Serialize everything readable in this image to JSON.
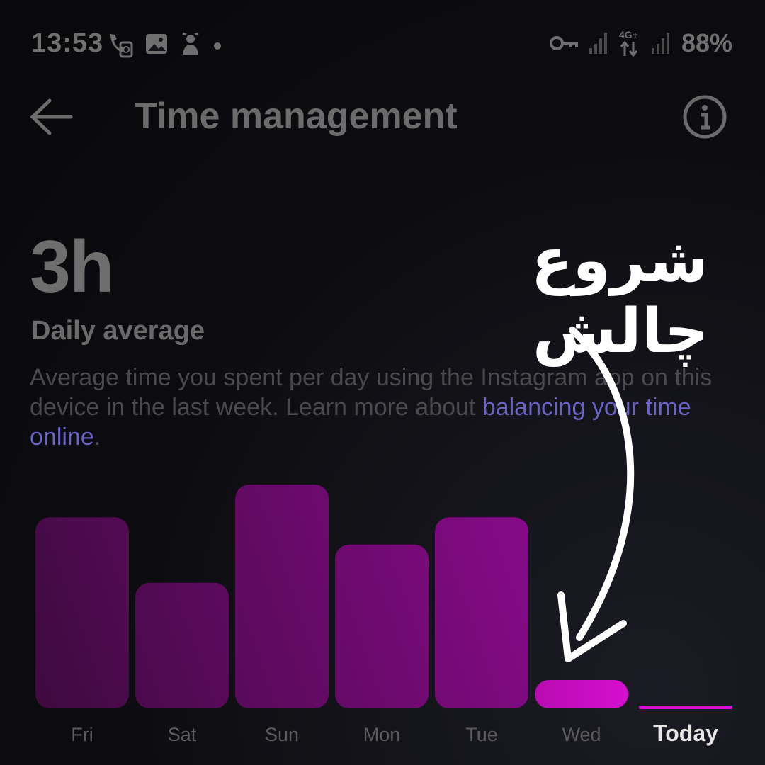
{
  "status_bar": {
    "time": "13:53",
    "battery": "88%",
    "network": "4G+"
  },
  "header": {
    "title": "Time management"
  },
  "summary": {
    "value": "3h",
    "label": "Daily average",
    "description_plain": "Average time you spent per day using the Instagram app on this device in the last week. Learn more about ",
    "description_link": "balancing your time online",
    "description_end": "."
  },
  "chart_data": {
    "type": "bar",
    "categories": [
      "Fri",
      "Sat",
      "Sun",
      "Mon",
      "Tue",
      "Wed",
      "Today"
    ],
    "values": [
      3.5,
      2.3,
      4.1,
      3.0,
      3.5,
      0.4,
      0.0
    ],
    "highlight": "Today",
    "colors": {
      "bar_dark": "#4a0a4a",
      "bar_light": "#8a0a8c",
      "bar_active": "#c90bc2",
      "today_line": "#d70fd0",
      "label": "#5c5c5c",
      "label_today": "#e6e6e6"
    }
  },
  "overlay": {
    "text": "شروع چالش",
    "arrow_color": "#ffffff"
  },
  "colors": {
    "background": "#0c0c0f",
    "muted_text": "#6e6e6e",
    "link": "#6a62c4"
  },
  "icons": [
    "back-arrow-icon",
    "info-icon",
    "wifi-call-icon",
    "gallery-icon",
    "notification-icon",
    "vpn-key-icon",
    "signal-icon"
  ]
}
